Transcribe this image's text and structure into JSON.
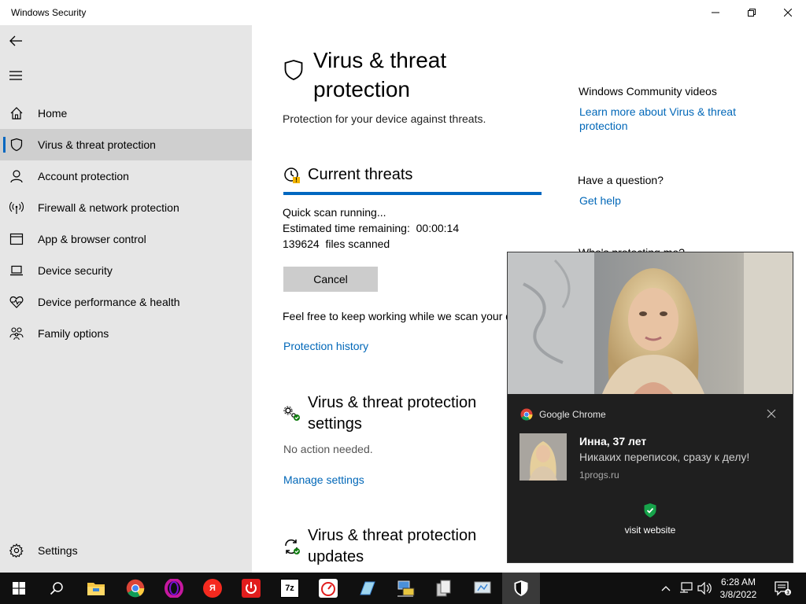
{
  "window": {
    "title": "Windows Security"
  },
  "sidebar": {
    "items": [
      {
        "label": "Home",
        "icon": "home-icon"
      },
      {
        "label": "Virus & threat protection",
        "icon": "shield-icon",
        "active": true
      },
      {
        "label": "Account protection",
        "icon": "person-icon"
      },
      {
        "label": "Firewall & network protection",
        "icon": "wifi-antenna-icon"
      },
      {
        "label": "App & browser control",
        "icon": "browser-window-icon"
      },
      {
        "label": "Device security",
        "icon": "laptop-icon"
      },
      {
        "label": "Device performance & health",
        "icon": "heart-pulse-icon"
      },
      {
        "label": "Family options",
        "icon": "family-icon"
      }
    ],
    "settings_label": "Settings"
  },
  "main": {
    "title": "Virus & threat protection",
    "subtitle": "Protection for your device against threats.",
    "current_threats": {
      "heading": "Current threats",
      "status": "Quick scan running...",
      "time_label": "Estimated time remaining:",
      "time_value": "00:00:14",
      "files_count": "139624",
      "files_label": "files scanned",
      "cancel_label": "Cancel",
      "note": "Feel free to keep working while we scan your device.",
      "history_link": "Protection history"
    },
    "settings_section": {
      "heading": "Virus & threat protection settings",
      "status": "No action needed.",
      "link": "Manage settings"
    },
    "updates_section": {
      "heading": "Virus & threat protection updates"
    }
  },
  "right_column": {
    "videos_heading": "Windows Community videos",
    "videos_link": "Learn more about Virus & threat protection",
    "question_heading": "Have a question?",
    "question_link": "Get help",
    "obscured_heading": "Who's protecting me?"
  },
  "toast": {
    "app_name": "Google Chrome",
    "heading": "Инна, 37 лет",
    "message": "Никаких переписок, сразу к делу!",
    "source": "1progs.ru",
    "action_label": "visit website"
  },
  "taskbar": {
    "apps": [
      "file-explorer",
      "chrome",
      "opera",
      "yandex",
      "power",
      "7zip",
      "speedtest",
      "app",
      "network",
      "documents",
      "app2",
      "windows-security"
    ],
    "clock_time": "6:28 AM",
    "clock_date": "3/8/2022"
  },
  "colors": {
    "accent": "#0067c0",
    "link": "#0067b8",
    "sidebar_bg": "#e6e6e6",
    "toast_bg": "#1f1f1f",
    "taskbar_bg": "#101010"
  }
}
